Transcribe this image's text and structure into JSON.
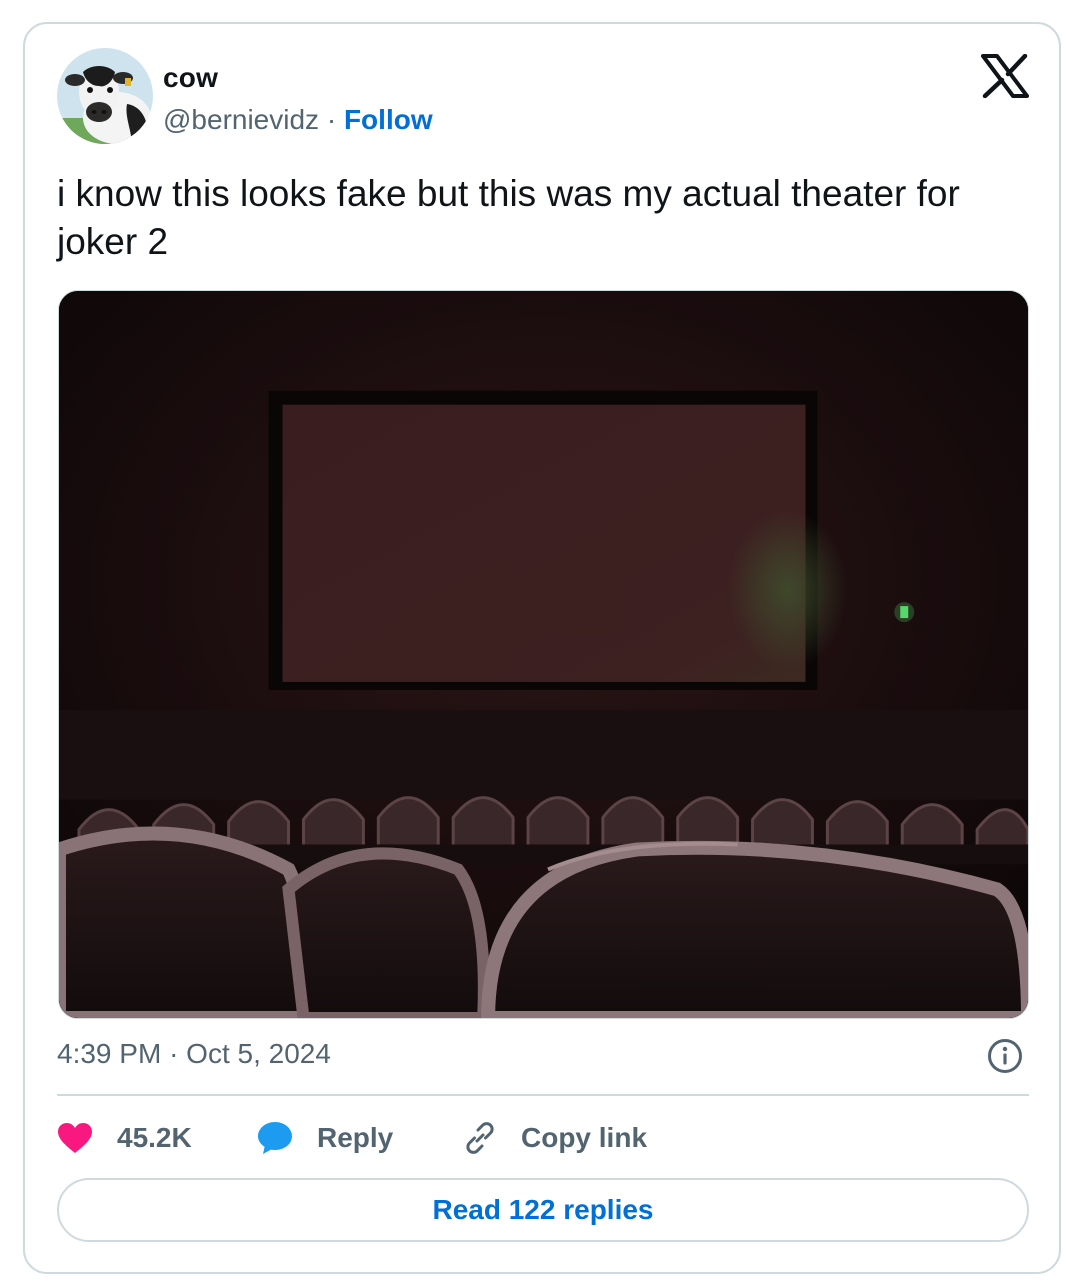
{
  "author": {
    "name": "cow",
    "handle": "@bernievidz",
    "separator": "·",
    "follow_label": "Follow"
  },
  "brand_icon": "x-logo-icon",
  "tweet": {
    "text": "i know this looks fake but this was my actual theater for joker 2"
  },
  "timestamp": {
    "time": "4:39 PM",
    "separator": "·",
    "date": "Oct 5, 2024"
  },
  "actions": {
    "like_count": "45.2K",
    "reply_label": "Reply",
    "copy_label": "Copy link"
  },
  "read_replies_label": "Read 122 replies",
  "colors": {
    "link_blue": "#006fd6",
    "heart_pink": "#f91880",
    "reply_bubble": "#1d9bf0",
    "text_secondary": "#536471",
    "border": "#cfd9de"
  },
  "icons": {
    "like": "heart-icon",
    "reply": "speech-bubble-icon",
    "copy": "link-icon",
    "info": "info-icon"
  }
}
